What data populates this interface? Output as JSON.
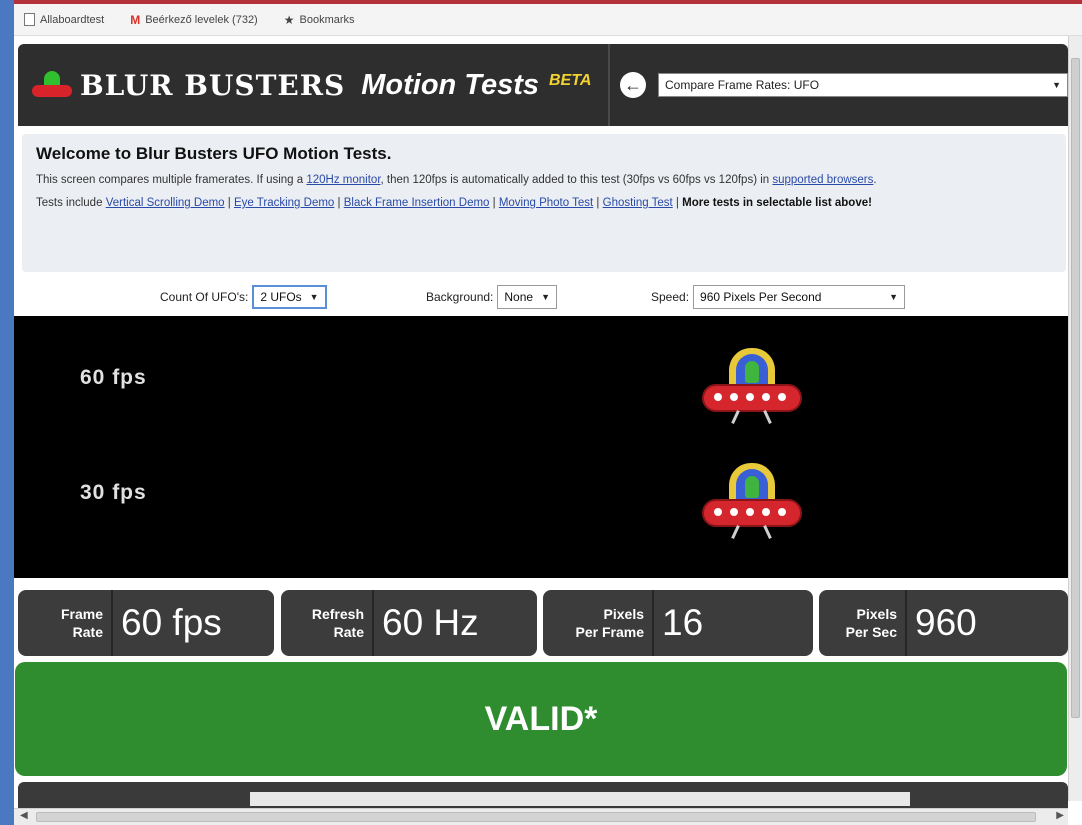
{
  "browser": {
    "bookmarks": [
      {
        "icon": "doc-icon",
        "label": "Allaboardtest"
      },
      {
        "icon": "gmail-icon",
        "label": "Beérkező levelek (732)"
      },
      {
        "icon": "star-icon",
        "label": "Bookmarks"
      }
    ]
  },
  "header": {
    "brand_name": "BLUR BUSTERS",
    "brand_sub": "Motion Tests",
    "beta": "BETA",
    "back_icon": "back-arrow-icon",
    "test_select": "Compare Frame Rates: UFO"
  },
  "welcome": {
    "title": "Welcome to Blur Busters UFO Motion Tests.",
    "p1_a": "This screen compares multiple framerates. If using a ",
    "p1_link1": "120Hz monitor",
    "p1_b": ", then 120fps is automatically added to this test (30fps vs 60fps vs 120fps) in ",
    "p1_link2": "supported browsers",
    "p1_c": ".",
    "p2_a": "Tests include ",
    "links": [
      "Vertical Scrolling Demo",
      "Eye Tracking Demo",
      "Black Frame Insertion Demo",
      "Moving Photo Test",
      "Ghosting Test"
    ],
    "sep": " | ",
    "p2_bold": "More tests in selectable list above!"
  },
  "controls": {
    "count_label": "Count Of UFO's:",
    "count_value": "2 UFOs",
    "bg_label": "Background:",
    "bg_value": "None",
    "speed_label": "Speed:",
    "speed_value": "960 Pixels Per Second"
  },
  "stage": {
    "rows": [
      {
        "label": "60 fps"
      },
      {
        "label": "30 fps"
      }
    ]
  },
  "stats": [
    {
      "label": "Frame\nRate",
      "value": "60 fps"
    },
    {
      "label": "Refresh\nRate",
      "value": "60 Hz"
    },
    {
      "label": "Pixels\nPer Frame",
      "value": "16"
    },
    {
      "label": "Pixels\nPer Sec",
      "value": "960"
    }
  ],
  "status": "VALID*",
  "colors": {
    "header_bg": "#2e2e2e",
    "beta": "#f2d230",
    "valid_bg": "#2f8d2f",
    "stat_bg": "#3c3c3c"
  }
}
